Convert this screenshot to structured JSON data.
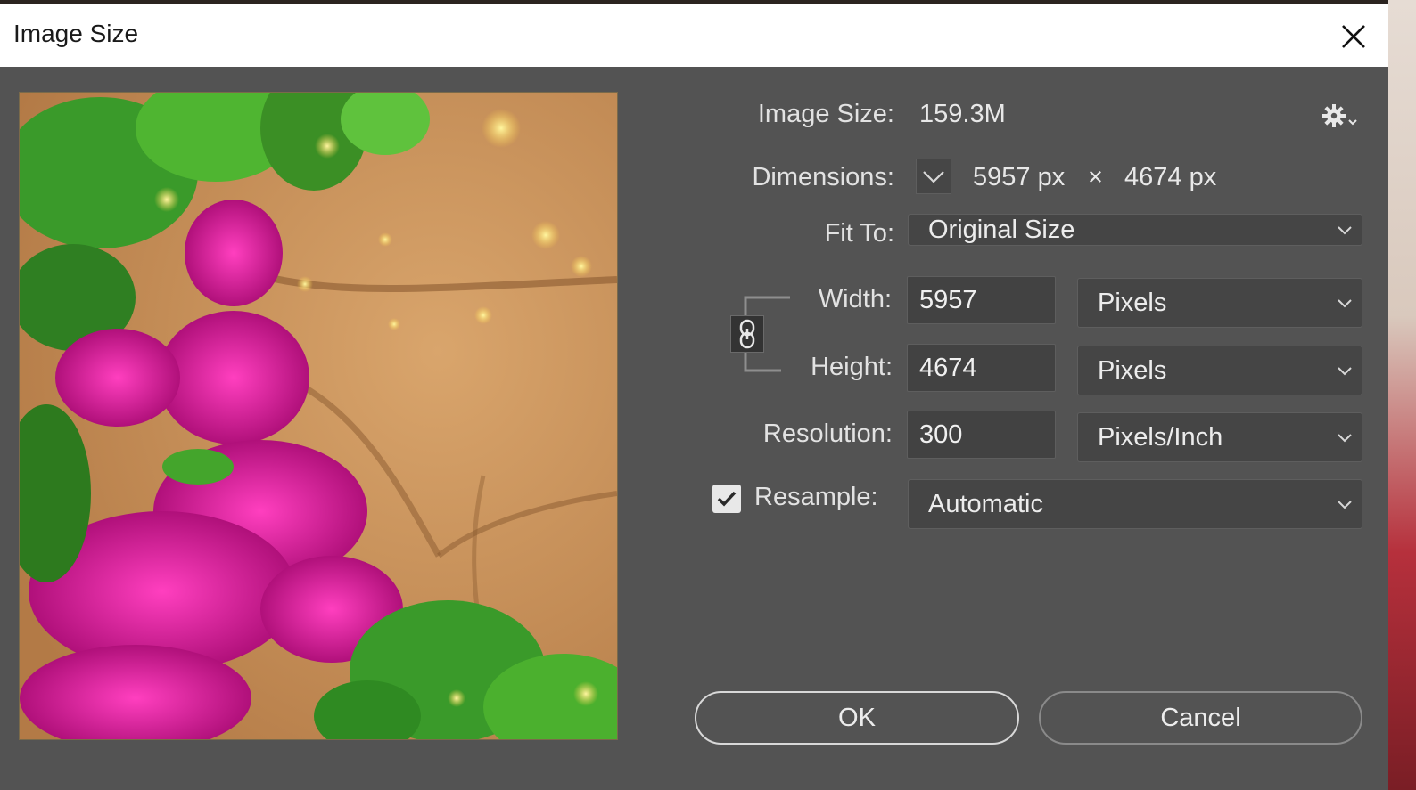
{
  "dialog": {
    "title": "Image Size"
  },
  "info": {
    "image_size_label": "Image Size:",
    "image_size_value": "159.3M",
    "dimensions_label": "Dimensions:",
    "dim_width": "5957 px",
    "dim_times": "×",
    "dim_height": "4674 px"
  },
  "fit_to": {
    "label": "Fit To:",
    "value": "Original Size"
  },
  "width": {
    "label": "Width:",
    "value": "5957",
    "unit": "Pixels"
  },
  "height": {
    "label": "Height:",
    "value": "4674",
    "unit": "Pixels"
  },
  "resolution": {
    "label": "Resolution:",
    "value": "300",
    "unit": "Pixels/Inch"
  },
  "resample": {
    "label": "Resample:",
    "checked": true,
    "value": "Automatic"
  },
  "buttons": {
    "ok": "OK",
    "cancel": "Cancel"
  },
  "icons": {
    "settings": "gear-icon",
    "close": "close-icon",
    "link": "chain-link-icon",
    "chevron": "chevron-down-icon"
  },
  "colors": {
    "dialog_bg": "#535353",
    "field_bg": "#424242",
    "text": "#e2e2e2",
    "titlebar": "#ffffff"
  }
}
